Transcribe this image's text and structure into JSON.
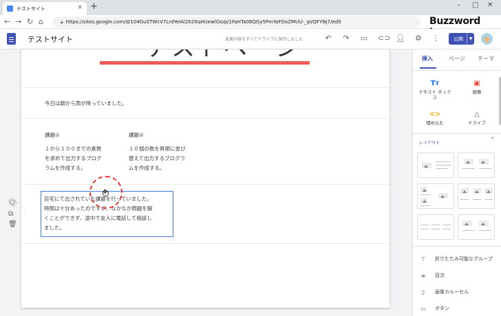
{
  "browser": {
    "tab_title": "テストサイト",
    "tab_close": "×",
    "new_tab": "+",
    "url": "https://sites.google.com/d/104GuSTWcV7LrdYeIAl2h2ltqHUewlOo/p/1FaHTa08QGy5PmYoFDoZMUU-_qVQFYNj7/edit",
    "back_icon": "←",
    "forward_icon": "→",
    "reload_icon": "↻",
    "home_icon": "⌂",
    "minimize": "–",
    "maximize": "□",
    "close": "✕"
  },
  "brand": "Buzzword Inc.",
  "sites_header": {
    "site_name": "テストサイト",
    "save_status": "変更内容をすべてドライブに保存しました",
    "publish_label": "公開"
  },
  "page": {
    "banner_title": "テストページ",
    "paragraph1": "今日は朝から雨が降っていました。",
    "col1_title": "課題①",
    "col1_body": "１から１００までの素数\nを求めて出力するプログ\nラムを作成する。",
    "col2_title": "課題②",
    "col2_body": "１０個の数を昇順に並び\n替えて出力するプログラ\nムを作成する。",
    "selected_text": "自宅にて出されていた課題を行っていました。\n時間は十分あったのですが、なかなか問題を解\nくことができず、途中で友人に電話して相談し\nました。"
  },
  "panel": {
    "tabs": [
      "挿入",
      "ページ",
      "テーマ"
    ],
    "insert_buttons": [
      {
        "icon": "Tт",
        "label": "テキスト ボック\nス",
        "color": "#1a73e8"
      },
      {
        "icon": "▣",
        "label": "画像",
        "color": "#ea4335"
      },
      {
        "icon": "<>",
        "label": "埋め込む",
        "color": "#f9ab00"
      },
      {
        "icon": "△",
        "label": "ドライブ",
        "color": "#5f6368"
      }
    ],
    "layout_header": "レイアウト",
    "items": [
      {
        "icon": "⊤",
        "label": "折りたたみ可能なグループ"
      },
      {
        "icon": "≡",
        "label": "目次"
      },
      {
        "icon": "▯",
        "label": "画像カルーセル"
      },
      {
        "icon": "▭",
        "label": "ボタン"
      }
    ]
  },
  "colors": {
    "accent": "#3f51b5",
    "banner_line": "#f25a5a",
    "annotation": "#e53935"
  }
}
